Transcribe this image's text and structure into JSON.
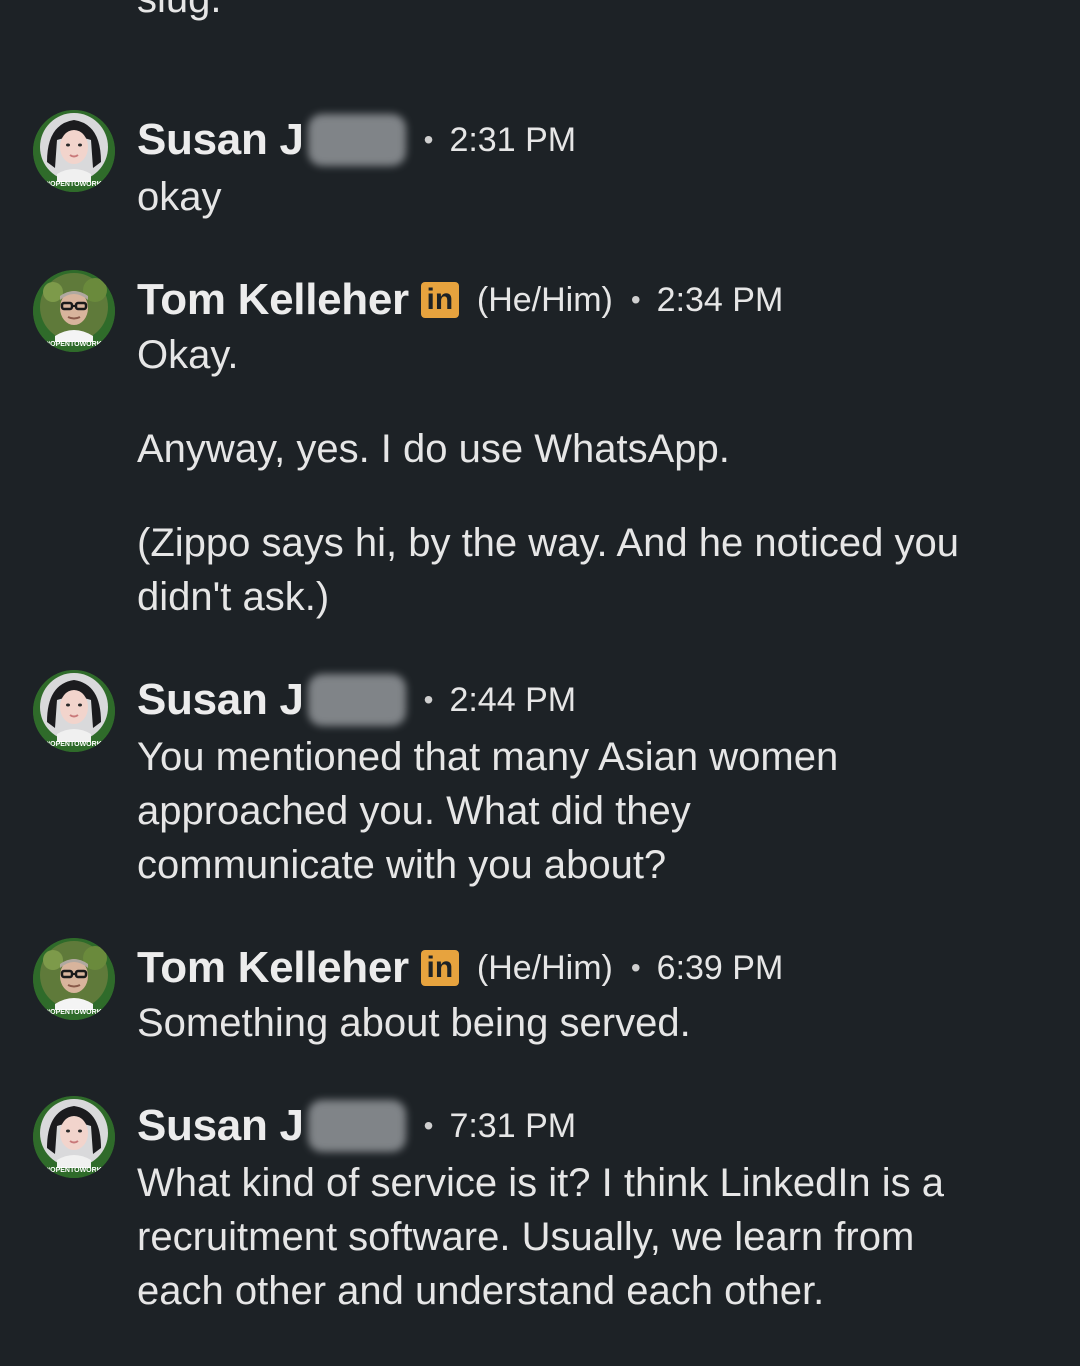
{
  "top_fragment": "slug.",
  "messages": [
    {
      "sender": "Susan J",
      "sender_blurred": true,
      "pronouns": "",
      "linkedin_badge": "",
      "time": "2:31 PM",
      "avatar": "woman-profile-photo",
      "paragraphs": [
        "okay"
      ]
    },
    {
      "sender": "Tom Kelleher",
      "sender_blurred": false,
      "pronouns": "(He/Him)",
      "linkedin_badge": "in",
      "time": "2:34 PM",
      "avatar": "man-profile-photo",
      "paragraphs": [
        "Okay.",
        "Anyway, yes.  I do use WhatsApp.",
        "(Zippo says hi, by the way.  And he noticed you didn't ask.)"
      ]
    },
    {
      "sender": "Susan J",
      "sender_blurred": true,
      "pronouns": "",
      "linkedin_badge": "",
      "time": "2:44 PM",
      "avatar": "woman-profile-photo",
      "paragraphs": [
        "You mentioned that many Asian women approached you. What did they communicate with you about?"
      ]
    },
    {
      "sender": "Tom Kelleher",
      "sender_blurred": false,
      "pronouns": "(He/Him)",
      "linkedin_badge": "in",
      "time": "6:39 PM",
      "avatar": "man-profile-photo",
      "paragraphs": [
        "Something about being served."
      ]
    },
    {
      "sender": "Susan J",
      "sender_blurred": true,
      "pronouns": "",
      "linkedin_badge": "",
      "time": "7:31 PM",
      "avatar": "woman-profile-photo",
      "paragraphs": [
        "What kind of service is it? I think LinkedIn is a recruitment software. Usually, we learn from each other and understand each other."
      ]
    }
  ],
  "avatar_frame_text": "#OPENTOWORK",
  "colors": {
    "background": "#1d2226",
    "text": "#e6e6e6",
    "linkedin_badge": "#e7a33e",
    "open_to_work_ring": "#2f6b2a"
  }
}
